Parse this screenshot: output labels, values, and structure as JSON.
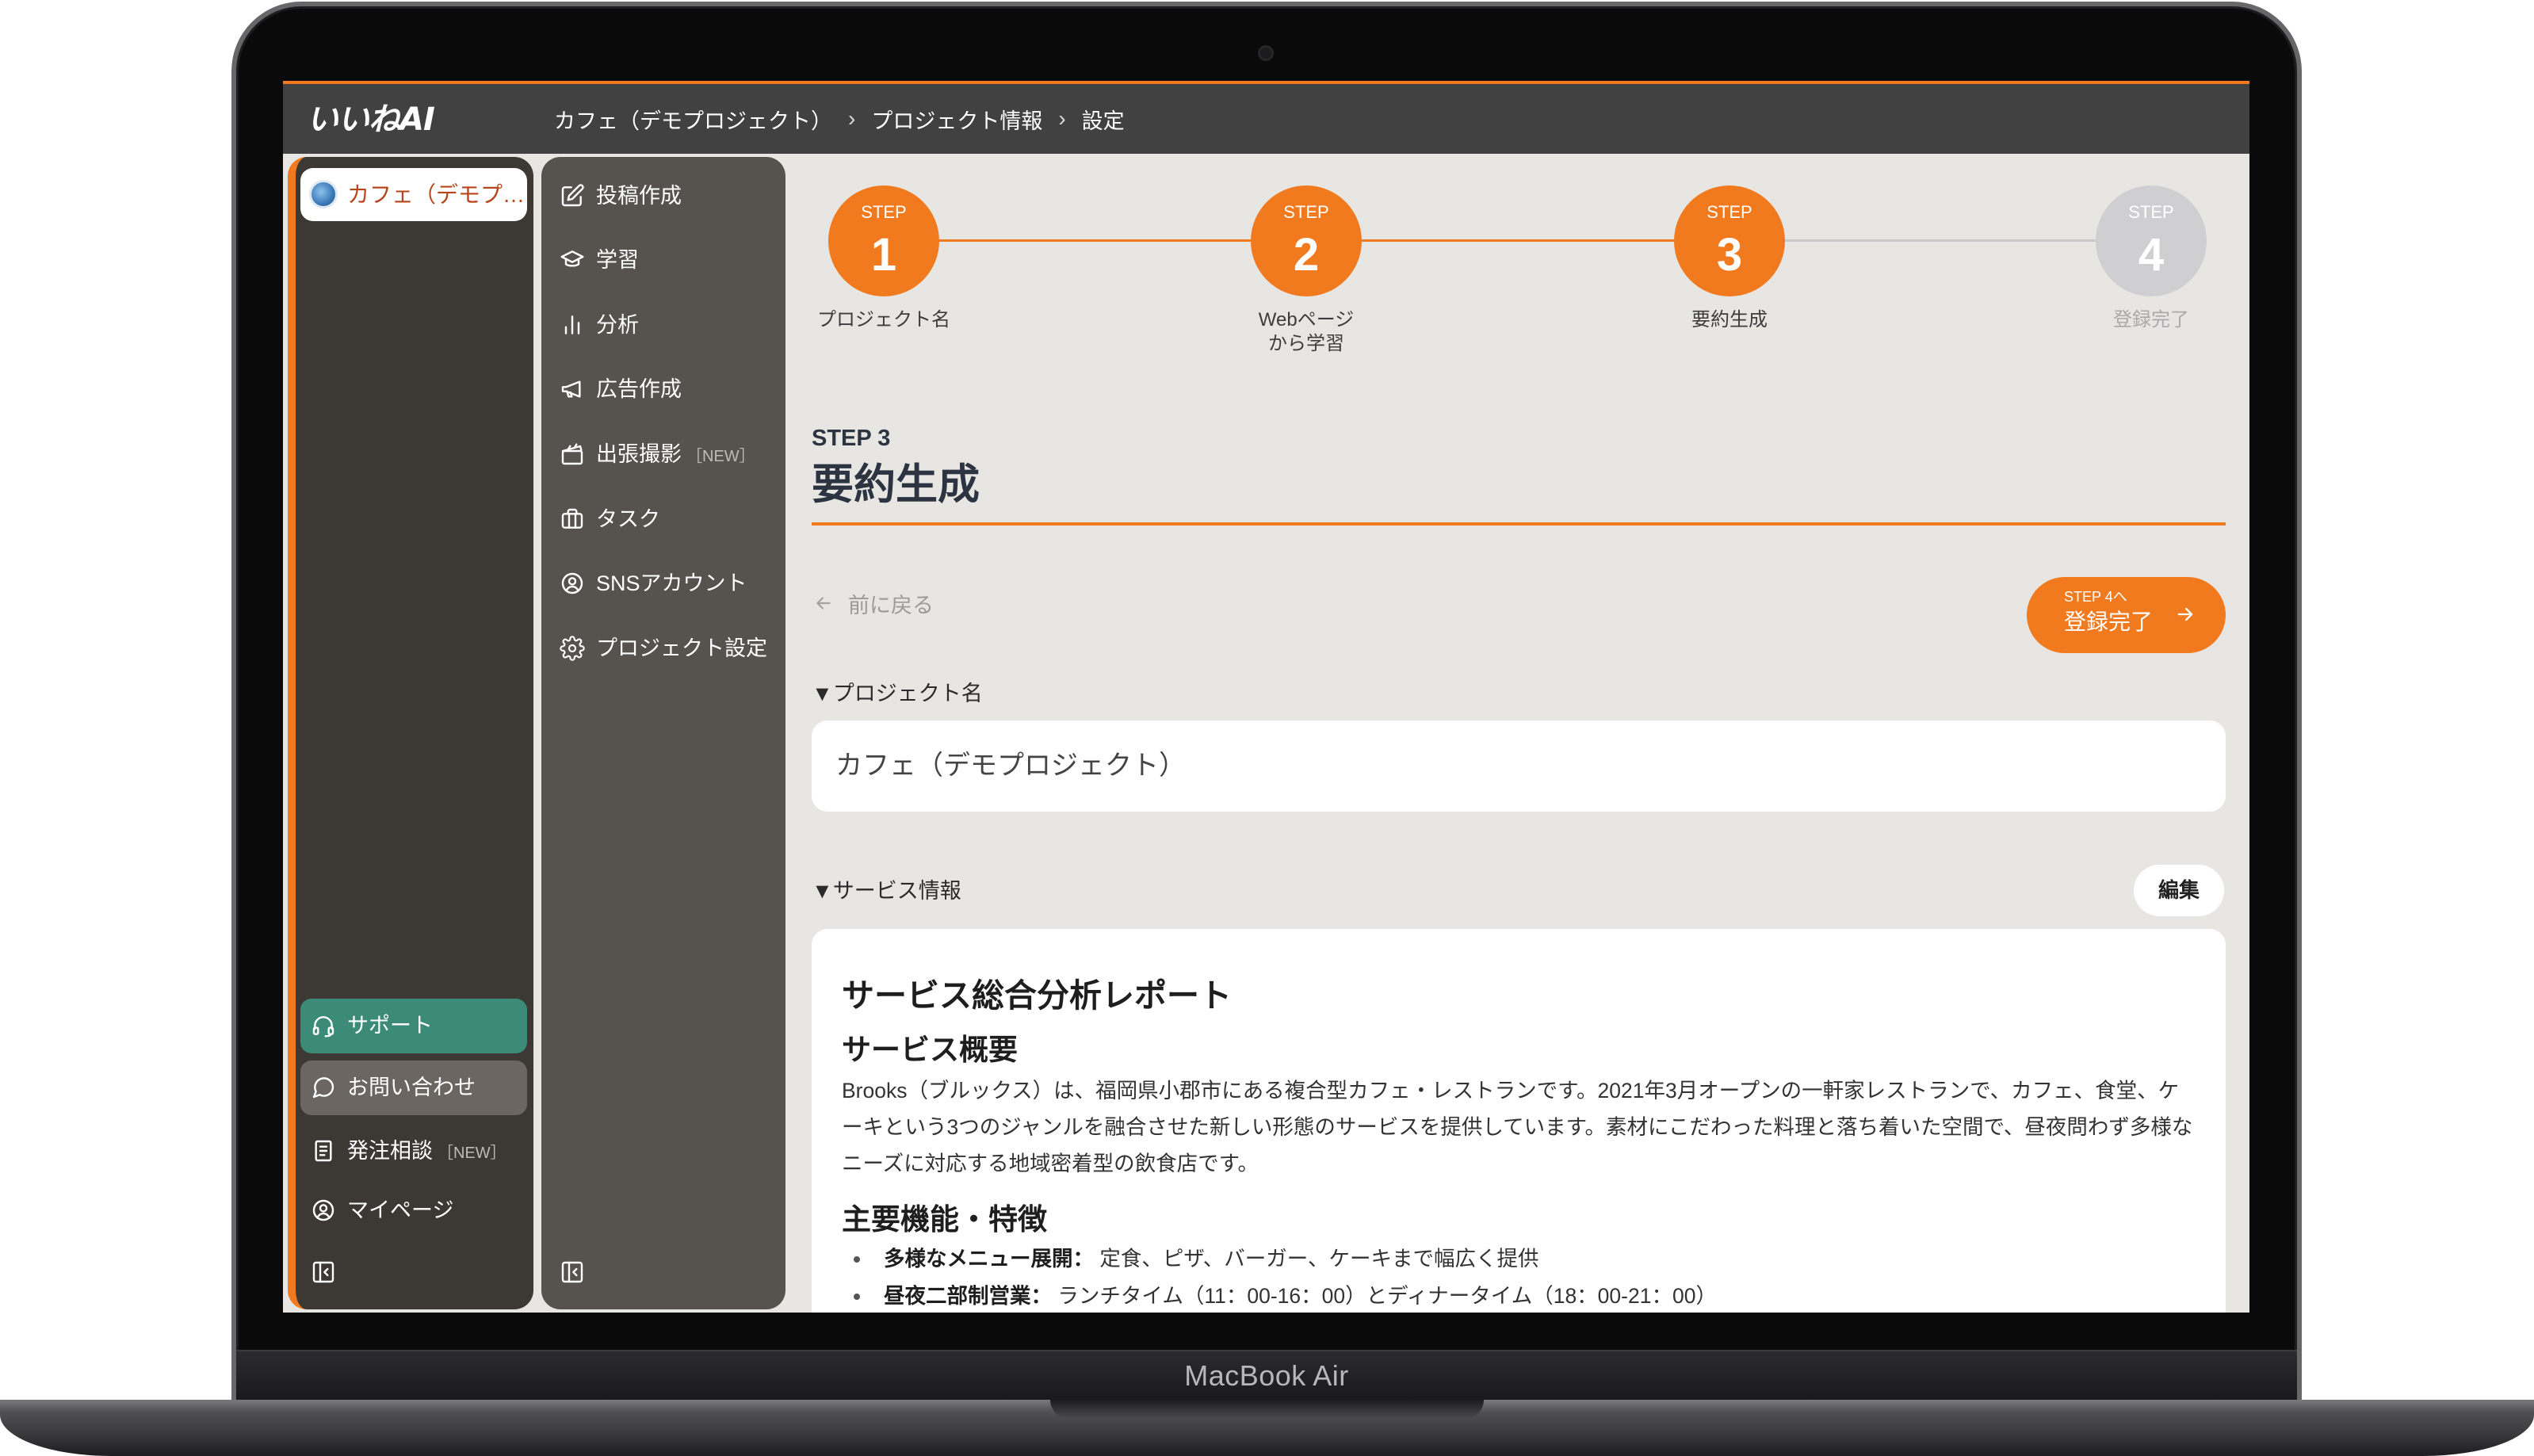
{
  "device": {
    "label": "MacBook Air"
  },
  "app": {
    "logo_text": "いいねAI"
  },
  "breadcrumb": {
    "items": [
      "カフェ（デモプロジェクト）",
      "プロジェクト情報",
      "設定"
    ],
    "separator": "›"
  },
  "sidebar_primary": {
    "project_name": "カフェ（デモプ…",
    "items": [
      {
        "label": "サポート",
        "icon": "headset-icon"
      },
      {
        "label": "お問い合わせ",
        "icon": "chat-bubble-icon"
      },
      {
        "label": "発注相談",
        "badge": "［NEW］",
        "icon": "document-icon"
      },
      {
        "label": "マイページ",
        "icon": "user-circle-icon"
      }
    ],
    "collapse_icon": "collapse-sidebar-icon"
  },
  "sidebar_secondary": {
    "items": [
      {
        "label": "投稿作成",
        "icon": "edit-icon"
      },
      {
        "label": "学習",
        "icon": "graduation-cap-icon"
      },
      {
        "label": "分析",
        "icon": "bar-chart-icon"
      },
      {
        "label": "広告作成",
        "icon": "megaphone-icon"
      },
      {
        "label": "出張撮影",
        "badge": "［NEW］",
        "icon": "clapperboard-icon"
      },
      {
        "label": "タスク",
        "icon": "briefcase-icon"
      },
      {
        "label": "SNSアカウント",
        "icon": "user-circle-icon"
      },
      {
        "label": "プロジェクト設定",
        "icon": "gear-icon"
      }
    ],
    "collapse_icon": "collapse-sidebar-icon"
  },
  "steps": [
    {
      "word": "STEP",
      "number": "1",
      "label": "プロジェクト名",
      "state": "completed"
    },
    {
      "word": "STEP",
      "number": "2",
      "label": "Webページ\nから学習",
      "state": "completed"
    },
    {
      "word": "STEP",
      "number": "3",
      "label": "要約生成",
      "state": "current"
    },
    {
      "word": "STEP",
      "number": "4",
      "label": "登録完了",
      "state": "upcoming"
    }
  ],
  "page": {
    "step_caption": "STEP 3",
    "title": "要約生成",
    "back_label": "前に戻る",
    "next_button": {
      "sub_label": "STEP 4へ",
      "label": "登録完了"
    },
    "project_name_section": {
      "heading": "▼プロジェクト名",
      "value": "カフェ（デモプロジェクト）"
    },
    "service_section": {
      "heading": "▼サービス情報",
      "edit_label": "編集"
    },
    "report": {
      "title": "サービス総合分析レポート",
      "overview_heading": "サービス概要",
      "overview_text": "Brooks（ブルックス）は、福岡県小郡市にある複合型カフェ・レストランです。2021年3月オープンの一軒家レストランで、カフェ、食堂、ケーキという3つのジャンルを融合させた新しい形態のサービスを提供しています。素材にこだわった料理と落ち着いた空間で、昼夜問わず多様なニーズに対応する地域密着型の飲食店です。",
      "features_heading": "主要機能・特徴",
      "features": [
        {
          "term": "多様なメニュー展開：",
          "desc": " 定食、ピザ、バーガー、ケーキまで幅広く提供"
        },
        {
          "term": "昼夜二部制営業：",
          "desc": " ランチタイム（11：00-16：00）とディナータイム（18：00-21：00）"
        }
      ]
    }
  },
  "colors": {
    "accent": "#f27a1e",
    "step_upcoming": "#cfcfd1",
    "topbar": "#414141",
    "sidebar_primary": "#3c3935",
    "sidebar_secondary": "#56534f",
    "support_green": "#3c8b78",
    "inquiry_gray": "#6b6661",
    "content_bg": "#e8e6e3",
    "project_name_text": "#b8461b"
  }
}
